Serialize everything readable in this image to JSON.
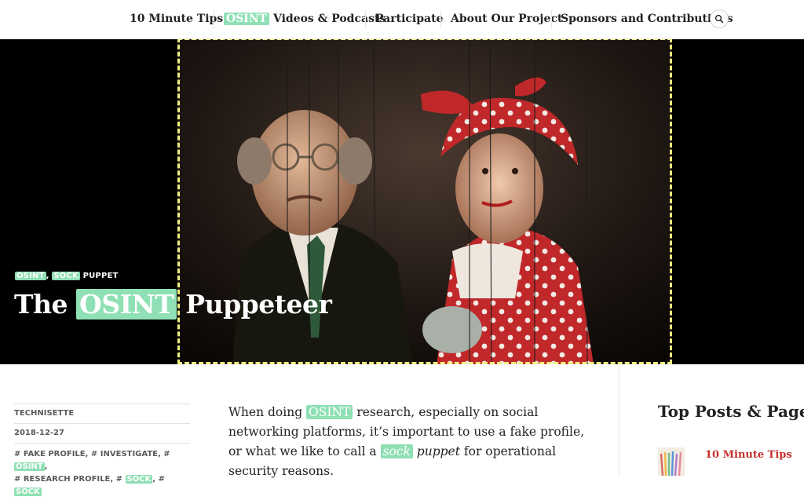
{
  "nav": {
    "items": [
      {
        "label": "10 Minute Tips"
      },
      {
        "highlight": "OSINT",
        "label": " Videos & Podcasts"
      },
      {
        "label": "Participate"
      },
      {
        "label": "About Our Project"
      },
      {
        "label": "Sponsors and Contributions"
      }
    ],
    "search_icon": "search-icon"
  },
  "hero": {
    "categories": {
      "cat1": "OSINT",
      "sep": ",",
      "cat2": "SOCK",
      "cat2_rest": " PUPPET"
    },
    "title": {
      "before": "The ",
      "highlight": "OSINT",
      "after": " Puppeteer"
    },
    "image": "marionette-puppets-photo"
  },
  "meta": {
    "author": "TECHNISETTE",
    "date": "2018-12-27",
    "tags_line1": [
      "# FAKE PROFILE, ",
      "# INVESTIGATE, ",
      "# ",
      "OSINT",
      ","
    ],
    "tags_line2": [
      "# RESEARCH PROFILE, ",
      "# ",
      "SOCK",
      ", # ",
      "SOCK"
    ]
  },
  "article": {
    "p1": "When doing ",
    "p1_hl": "OSINT",
    "p2": " research, especially on social networking platforms, it’s important to use a fake profile, or what we like to call a ",
    "p2_hl": "sock",
    "p3_it": " puppet",
    "p4": " for operational security reasons."
  },
  "sidebar": {
    "title": "Top Posts & Pages",
    "link": "10 Minute Tips"
  },
  "colors": {
    "highlight": "#8fe0b4",
    "link_red": "#c4302b",
    "frame_dash": "#f4f080"
  }
}
